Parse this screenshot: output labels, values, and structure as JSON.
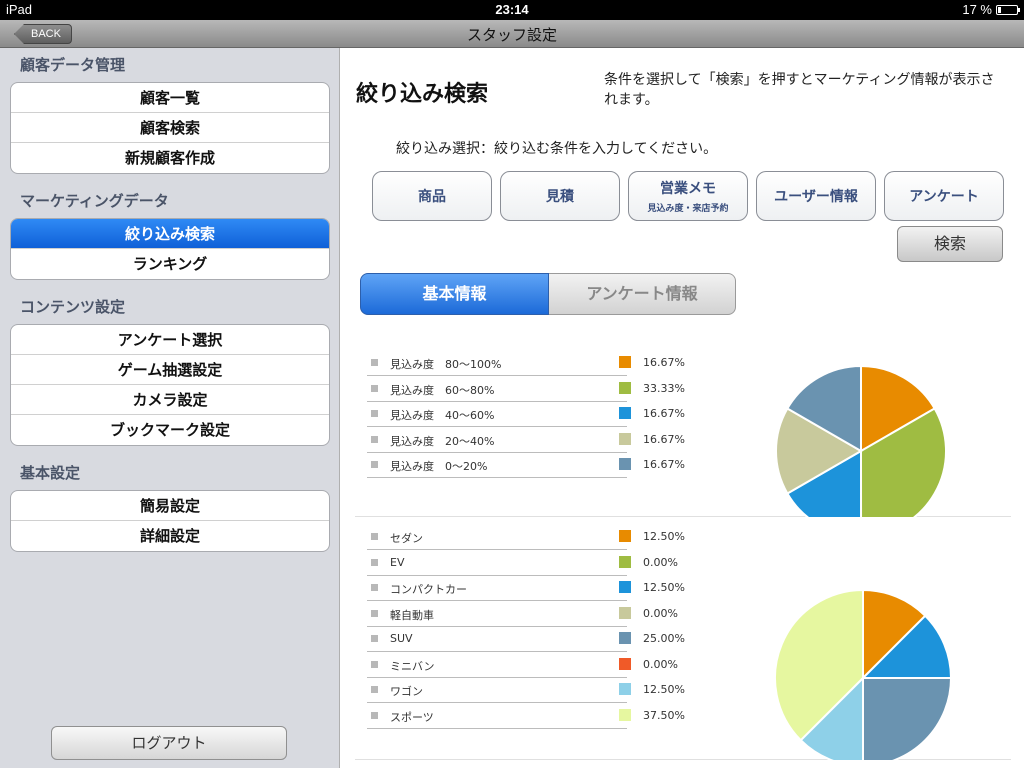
{
  "status_bar": {
    "device": "iPad",
    "time": "23:14",
    "battery": "17 %",
    "battery_level": 0.17
  },
  "nav": {
    "back_label": "BACK",
    "title": "スタッフ設定"
  },
  "sidebar": {
    "sections": [
      {
        "title": "顧客データ管理",
        "items": [
          "顧客一覧",
          "顧客検索",
          "新規顧客作成"
        ]
      },
      {
        "title": "マーケティングデータ",
        "items": [
          "絞り込み検索",
          "ランキング"
        ]
      },
      {
        "title": "コンテンツ設定",
        "items": [
          "アンケート選択",
          "ゲーム抽選設定",
          "カメラ設定",
          "ブックマーク設定"
        ]
      },
      {
        "title": "基本設定",
        "items": [
          "簡易設定",
          "詳細設定"
        ]
      }
    ],
    "active_item": "絞り込み検索",
    "logout_label": "ログアウト"
  },
  "main": {
    "title": "絞り込み検索",
    "hint": "条件を選択して「検索」を押すとマーケティング情報が表示されます。",
    "filter_label": "絞り込み選択：絞り込む条件を入力してください。",
    "filter_buttons": [
      {
        "label": "商品",
        "sub": ""
      },
      {
        "label": "見積",
        "sub": ""
      },
      {
        "label": "営業メモ",
        "sub": "見込み度・来店予約"
      },
      {
        "label": "ユーザー情報",
        "sub": ""
      },
      {
        "label": "アンケート",
        "sub": ""
      }
    ],
    "search_label": "検索",
    "tabs": [
      {
        "label": "基本情報",
        "active": true
      },
      {
        "label": "アンケート情報",
        "active": false
      }
    ]
  },
  "chart_data": [
    {
      "type": "pie",
      "categories": [
        "見込み度　80〜100%",
        "見込み度　60〜80%",
        "見込み度　40〜60%",
        "見込み度　20〜40%",
        "見込み度　0〜20%"
      ],
      "values": [
        16.67,
        33.33,
        16.67,
        16.67,
        16.67
      ],
      "labels": [
        "16.67%",
        "33.33%",
        "16.67%",
        "16.67%",
        "16.67%"
      ],
      "colors": [
        "#e88b00",
        "#9fbc42",
        "#1d93da",
        "#c8c99c",
        "#6a93b0"
      ]
    },
    {
      "type": "pie",
      "categories": [
        "セダン",
        "EV",
        "コンパクトカー",
        "軽自動車",
        "SUV",
        "ミニバン",
        "ワゴン",
        "スポーツ"
      ],
      "values": [
        12.5,
        0,
        12.5,
        0,
        25,
        0,
        12.5,
        37.5
      ],
      "labels": [
        "12.50%",
        "0.00%",
        "12.50%",
        "0.00%",
        "25.00%",
        "0.00%",
        "12.50%",
        "37.50%"
      ],
      "colors": [
        "#e88b00",
        "#9fbc42",
        "#1d93da",
        "#c8c99c",
        "#6a93b0",
        "#f05a28",
        "#8ed0e8",
        "#e6f7a0"
      ]
    }
  ]
}
